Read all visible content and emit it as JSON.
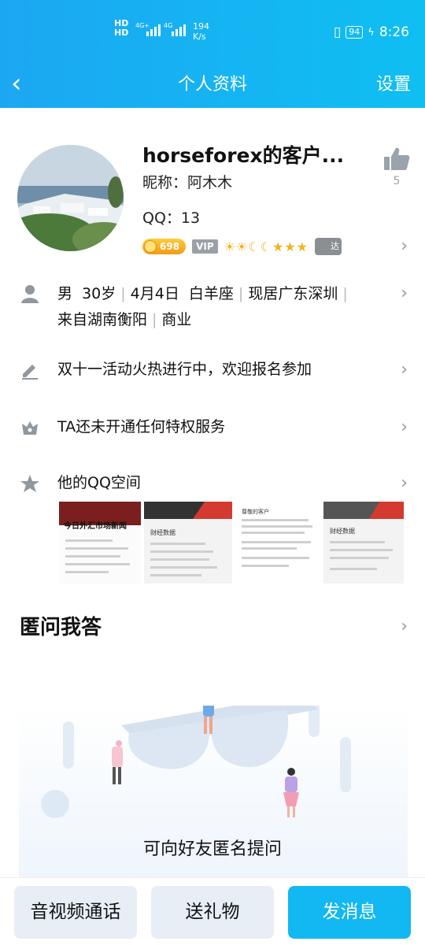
{
  "status_bar": {
    "hd1": "HD",
    "hd2": "HD",
    "net1": "4G+",
    "net2": "4G",
    "speed_value": "194",
    "speed_unit": "K/s",
    "battery": "94",
    "time": "8:26"
  },
  "nav": {
    "back": "‹",
    "title": "个人资料",
    "settings": "设置"
  },
  "profile": {
    "name": "horseforex的客户...",
    "nickname": "昵称：阿木木",
    "qq": "QQ：13",
    "likes": "5",
    "coin_level": "698",
    "vip": "VIP",
    "level_icons": "☀☀☾☾★★★",
    "ta_badge": "达"
  },
  "info": {
    "gender": "男",
    "age": "30岁",
    "birthday": "4月4日",
    "zodiac": "白羊座",
    "location": "现居广东深圳",
    "hometown": "来自湖南衡阳",
    "industry": "商业"
  },
  "rows": {
    "signature": "双十一活动火热进行中，欢迎报名参加",
    "privilege": "TA还未开通任何特权服务",
    "qzone": "他的QQ空间"
  },
  "qzone_thumbs": [
    {
      "title": "今日外汇市场新闻"
    },
    {
      "title": "财经数据"
    },
    {
      "title": "尊敬的客户"
    },
    {
      "title": "财经数据"
    }
  ],
  "anon": {
    "heading": "匿问我答",
    "prompt": "可向好友匿名提问"
  },
  "actions": {
    "call": "音视频通话",
    "gift": "送礼物",
    "message": "发消息"
  },
  "colors": {
    "header": "#12b4f2",
    "primary_button": "#11b8f2",
    "secondary_button": "#e8eef6"
  }
}
